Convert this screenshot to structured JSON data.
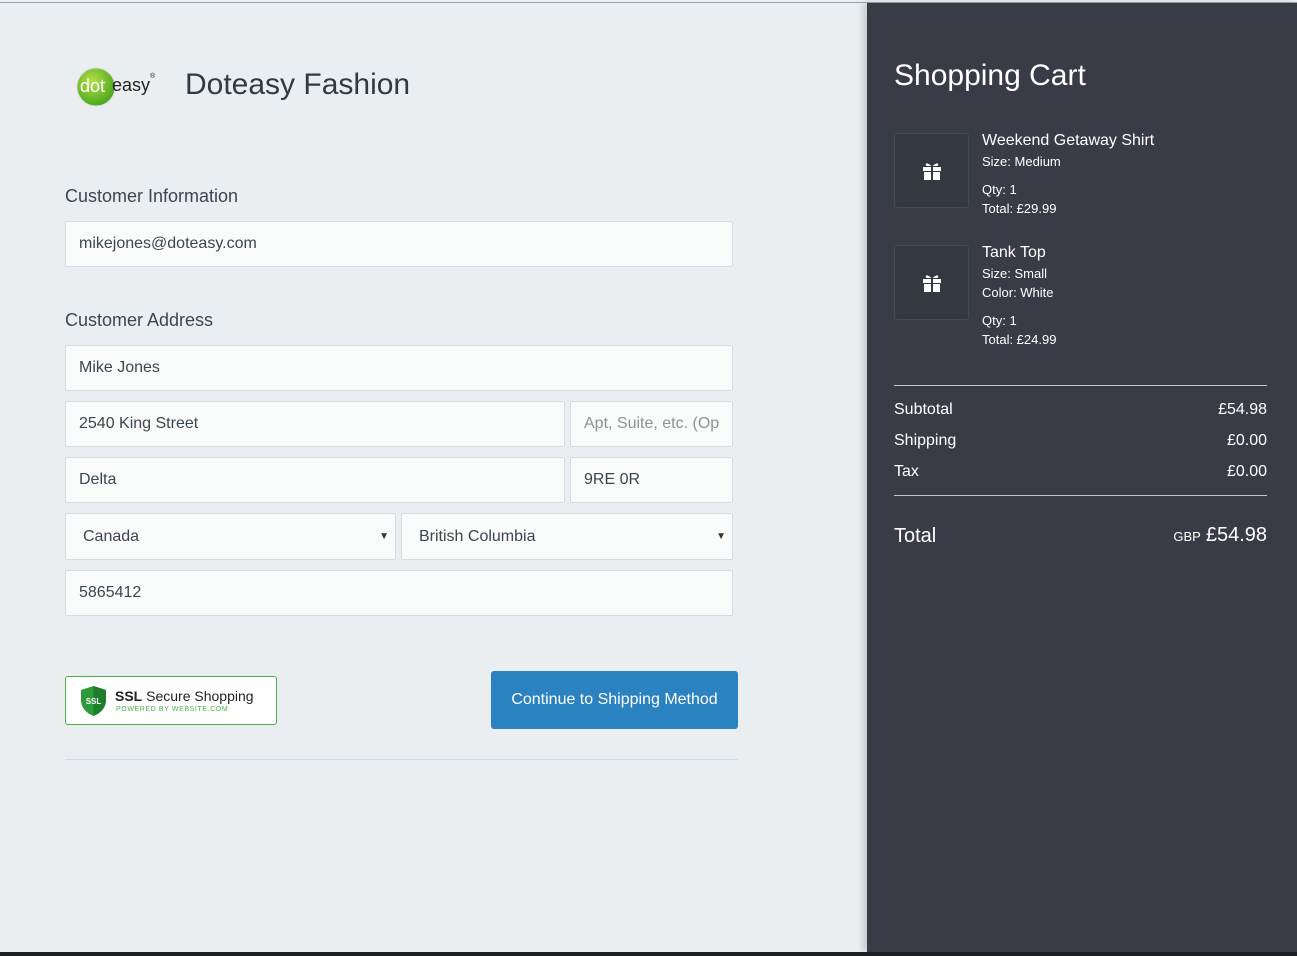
{
  "store": {
    "name": "Doteasy Fashion",
    "logo_text_dot": "dot",
    "logo_text_easy": "easy"
  },
  "customer_info": {
    "title": "Customer Information",
    "email": "mikejones@doteasy.com"
  },
  "customer_address": {
    "title": "Customer Address",
    "name": "Mike Jones",
    "street": "2540 King Street",
    "apt_placeholder": "Apt, Suite, etc. (Op",
    "city": "Delta",
    "postal": "9RE 0R",
    "country": "Canada",
    "province": "British Columbia",
    "phone": "5865412"
  },
  "ssl_badge": {
    "shield_text": "SSL",
    "title_bold": "SSL",
    "title_rest": "Secure Shopping",
    "subtitle": "POWERED BY WEBSITE.COM"
  },
  "continue_button": "Continue to Shipping Method",
  "cart": {
    "title": "Shopping Cart",
    "items": [
      {
        "name": "Weekend Getaway Shirt",
        "size": "Size: Medium",
        "qty": "Qty: 1",
        "total": "Total: £29.99"
      },
      {
        "name": "Tank Top",
        "size": "Size: Small",
        "color": "Color: White",
        "qty": "Qty: 1",
        "total": "Total: £24.99"
      }
    ],
    "subtotal_label": "Subtotal",
    "subtotal": "£54.98",
    "shipping_label": "Shipping",
    "shipping": "£0.00",
    "tax_label": "Tax",
    "tax": "£0.00",
    "total_label": "Total",
    "currency": "GBP",
    "total": "£54.98"
  },
  "colors": {
    "page_bg": "#eaeef0",
    "cart_bg": "#393b47",
    "button": "#2b82c0",
    "ssl_green": "#4cae4c"
  }
}
